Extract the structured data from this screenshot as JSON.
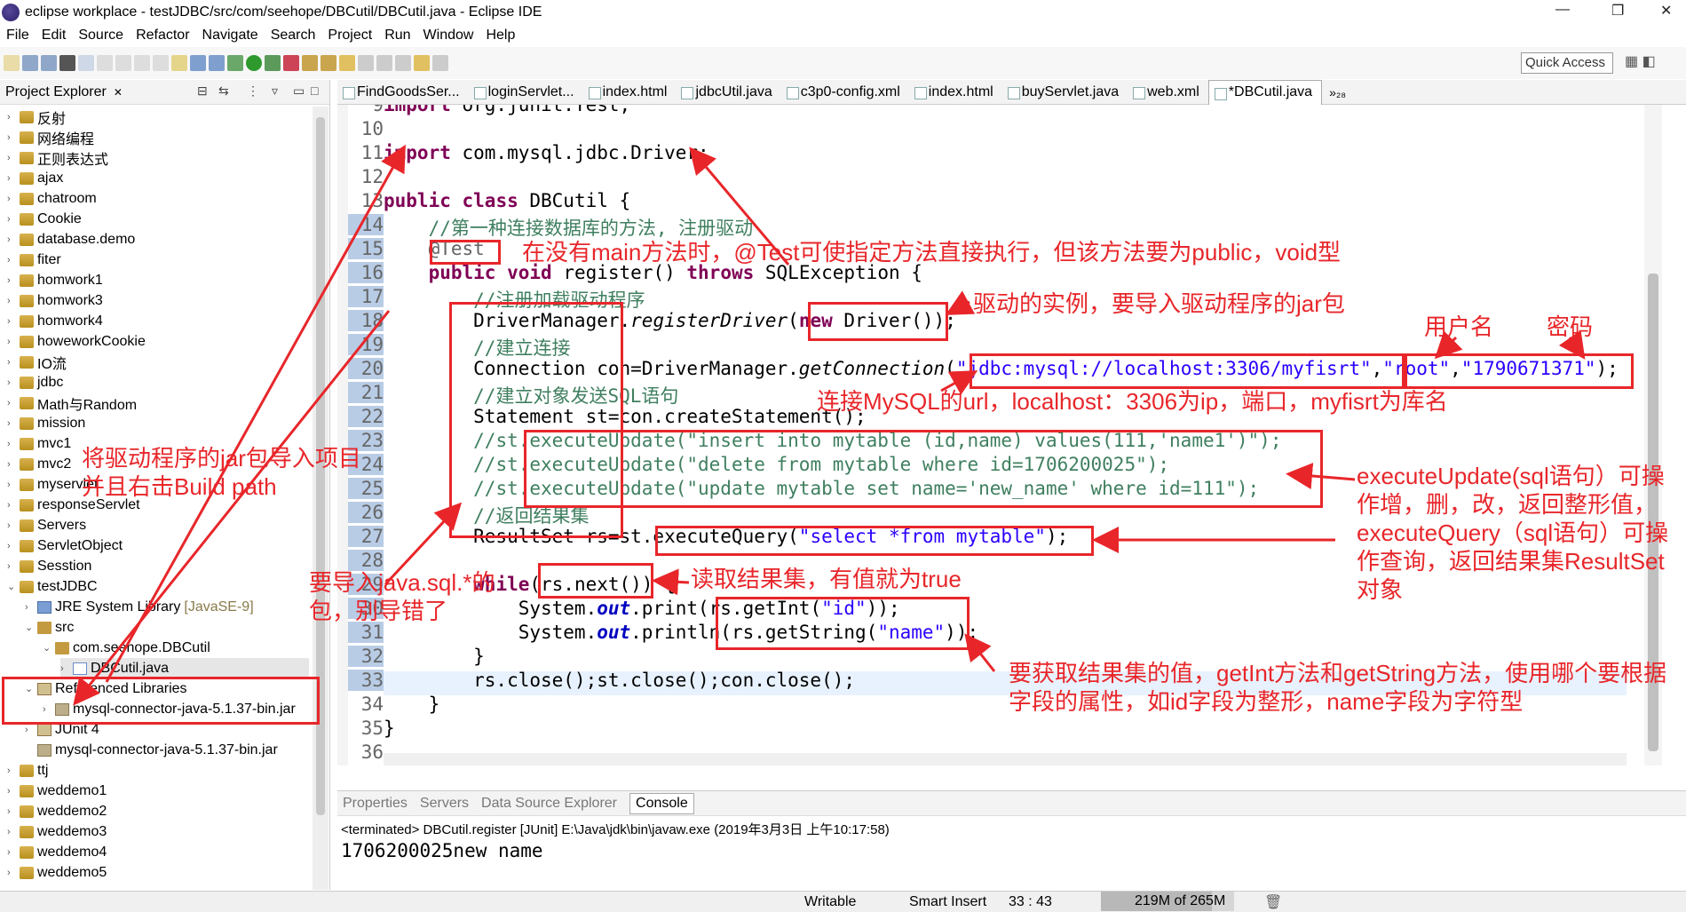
{
  "window": {
    "title": "eclipse workplace - testJDBC/src/com/seehope/DBCutil/DBCutil.java - Eclipse IDE"
  },
  "menu": [
    "File",
    "Edit",
    "Source",
    "Refactor",
    "Navigate",
    "Search",
    "Project",
    "Run",
    "Window",
    "Help"
  ],
  "toolbar": {
    "quick_access": "Quick Access"
  },
  "project_explorer": {
    "title": "Project Explorer",
    "items": [
      {
        "label": "反射",
        "indent": 0,
        "icon": "proj",
        "arrow": ">"
      },
      {
        "label": "网络编程",
        "indent": 0,
        "icon": "proj",
        "arrow": ">"
      },
      {
        "label": "正则表达式",
        "indent": 0,
        "icon": "proj",
        "arrow": ">"
      },
      {
        "label": "ajax",
        "indent": 0,
        "icon": "proj",
        "arrow": ">"
      },
      {
        "label": "chatroom",
        "indent": 0,
        "icon": "proj",
        "arrow": ">"
      },
      {
        "label": "Cookie",
        "indent": 0,
        "icon": "proj",
        "arrow": ">"
      },
      {
        "label": "database.demo",
        "indent": 0,
        "icon": "proj",
        "arrow": ">"
      },
      {
        "label": "fiter",
        "indent": 0,
        "icon": "proj",
        "arrow": ">"
      },
      {
        "label": "homwork1",
        "indent": 0,
        "icon": "proj",
        "arrow": ">"
      },
      {
        "label": "homwork3",
        "indent": 0,
        "icon": "proj",
        "arrow": ">"
      },
      {
        "label": "homwork4",
        "indent": 0,
        "icon": "proj",
        "arrow": ">"
      },
      {
        "label": "howeworkCookie",
        "indent": 0,
        "icon": "proj",
        "arrow": ">"
      },
      {
        "label": "IO流",
        "indent": 0,
        "icon": "proj",
        "arrow": ">"
      },
      {
        "label": "jdbc",
        "indent": 0,
        "icon": "proj",
        "arrow": ">"
      },
      {
        "label": "Math与Random",
        "indent": 0,
        "icon": "proj",
        "arrow": ">"
      },
      {
        "label": "mission",
        "indent": 0,
        "icon": "proj",
        "arrow": ">"
      },
      {
        "label": "mvc1",
        "indent": 0,
        "icon": "proj",
        "arrow": ">"
      },
      {
        "label": "mvc2",
        "indent": 0,
        "icon": "proj",
        "arrow": ">"
      },
      {
        "label": "myservlet",
        "indent": 0,
        "icon": "proj",
        "arrow": ">"
      },
      {
        "label": "responseServlet",
        "indent": 0,
        "icon": "proj",
        "arrow": ">"
      },
      {
        "label": "Servers",
        "indent": 0,
        "icon": "proj",
        "arrow": ">"
      },
      {
        "label": "ServletObject",
        "indent": 0,
        "icon": "proj",
        "arrow": ">"
      },
      {
        "label": "Sesstion",
        "indent": 0,
        "icon": "proj",
        "arrow": ">"
      },
      {
        "label": "testJDBC",
        "indent": 0,
        "icon": "proj",
        "arrow": "v"
      },
      {
        "label": "JRE System Library",
        "extra": "[JavaSE-9]",
        "indent": 1,
        "icon": "jre",
        "arrow": ">"
      },
      {
        "label": "src",
        "indent": 1,
        "icon": "pkg",
        "arrow": "v"
      },
      {
        "label": "com.seehope.DBCutil",
        "indent": 2,
        "icon": "pkg",
        "arrow": "v"
      },
      {
        "label": "DBCutil.java",
        "indent": 3,
        "icon": "java",
        "arrow": ">",
        "selected": true
      },
      {
        "label": "Referenced Libraries",
        "indent": 1,
        "icon": "lib",
        "arrow": "v"
      },
      {
        "label": "mysql-connector-java-5.1.37-bin.jar",
        "indent": 2,
        "icon": "jar",
        "arrow": ">"
      },
      {
        "label": "JUnit 4",
        "indent": 1,
        "icon": "lib",
        "arrow": ">"
      },
      {
        "label": "mysql-connector-java-5.1.37-bin.jar",
        "indent": 1,
        "icon": "jar",
        "arrow": ""
      },
      {
        "label": "ttj",
        "indent": 0,
        "icon": "proj",
        "arrow": ">"
      },
      {
        "label": "weddemo1",
        "indent": 0,
        "icon": "proj",
        "arrow": ">"
      },
      {
        "label": "weddemo2",
        "indent": 0,
        "icon": "proj",
        "arrow": ">"
      },
      {
        "label": "weddemo3",
        "indent": 0,
        "icon": "proj",
        "arrow": ">"
      },
      {
        "label": "weddemo4",
        "indent": 0,
        "icon": "proj",
        "arrow": ">"
      },
      {
        "label": "weddemo5",
        "indent": 0,
        "icon": "proj",
        "arrow": ">"
      }
    ]
  },
  "editor_tabs": [
    "FindGoodsSer...",
    "loginServlet...",
    "index.html",
    "jdbcUtil.java",
    "c3p0-config.xml",
    "index.html",
    "buyServlet.java",
    "web.xml",
    "*DBCutil.java"
  ],
  "editor_tabs_more": "»₂₈",
  "code_lines": [
    {
      "n": "9",
      "html": "<span class='kw'>import</span> org.junit.Test;"
    },
    {
      "n": "10",
      "html": ""
    },
    {
      "n": "11",
      "html": "<span class='kw'>import</span> com.mysql.jdbc.Driver;"
    },
    {
      "n": "12",
      "html": ""
    },
    {
      "n": "13",
      "html": "<span class='kw'>public</span> <span class='kw'>class</span> DBCutil {"
    },
    {
      "n": "14",
      "html": "    <span class='cm'>//第一种连接数据库的方法, 注册驱动</span>"
    },
    {
      "n": "15",
      "html": "    <span class='ann'>@Test</span>"
    },
    {
      "n": "16",
      "html": "    <span class='kw'>public</span> <span class='kw'>void</span> register() <span class='kw'>throws</span> SQLException {"
    },
    {
      "n": "17",
      "html": "        <span class='cm'>//注册加载驱动程序</span>"
    },
    {
      "n": "18",
      "html": "        DriverManager.<span class='it'>registerDriver</span>(<span class='kw'>new</span> Driver());"
    },
    {
      "n": "19",
      "html": "        <span class='cm'>//建立连接</span>"
    },
    {
      "n": "20",
      "html": "        Connection con=DriverManager.<span class='it'>getConnection</span>(<span class='str'>\"jdbc:mysql://localhost:3306/myfisrt\"</span>,<span class='str'>\"root\"</span>,<span class='str'>\"1790671371\"</span>);"
    },
    {
      "n": "21",
      "html": "        <span class='cm'>//建立对象发送SQL语句</span>"
    },
    {
      "n": "22",
      "html": "        Statement st=con.createStatement();"
    },
    {
      "n": "23",
      "html": "        <span class='cm'>//st.executeUpdate(\"insert into mytable (id,name) values(111,'name1')\");</span>"
    },
    {
      "n": "24",
      "html": "        <span class='cm'>//st.executeUpdate(\"delete from mytable where id=1706200025\");</span>"
    },
    {
      "n": "25",
      "html": "        <span class='cm'>//st.executeUpdate(\"update mytable set name='new_name' where id=111\");</span>"
    },
    {
      "n": "26",
      "html": "        <span class='cm'>//返回结果集</span>"
    },
    {
      "n": "27",
      "html": "        ResultSet rs=st.executeQuery(<span class='str'>\"select *from mytable\"</span>);"
    },
    {
      "n": "28",
      "html": ""
    },
    {
      "n": "29",
      "html": "        <span class='kw'>while</span>(rs.next()) {"
    },
    {
      "n": "30",
      "html": "            System.<span class='fld'>out</span>.print(rs.getInt(<span class='str'>\"id\"</span>));"
    },
    {
      "n": "31",
      "html": "            System.<span class='fld'>out</span>.println(rs.getString(<span class='str'>\"name\"</span>));"
    },
    {
      "n": "32",
      "html": "        }"
    },
    {
      "n": "33",
      "html": "        rs.close();st.close();con.close();"
    },
    {
      "n": "34",
      "html": "    }"
    },
    {
      "n": "35",
      "html": "}"
    },
    {
      "n": "36",
      "html": ""
    }
  ],
  "annotations": {
    "test": "在没有main方法时，@Test可使指定方法直接执行，但该方法要为public，void型",
    "driver": "驱动的实例，要导入驱动程序的jar包",
    "username": "用户名",
    "password": "密码",
    "url": "连接MySQL的url，localhost：3306为ip，端口，myfisrt为库名",
    "jar_import_1": "将驱动程序的jar包导入项目",
    "jar_import_2": "并且右击Build path",
    "exec_update_1": "executeUpdate(sql语句）可操",
    "exec_update_2": "作增，删，改，返回整形值，",
    "exec_query_1": "executeQuery（sql语句）可操",
    "exec_query_2": "作查询，返回结果集ResultSet",
    "exec_query_3": "对象",
    "rs_next": "读取结果集，有值就为true",
    "import_sql_1": "要导入java.sql.*的",
    "import_sql_2": "包，别导错了",
    "getvalue_1": "要获取结果集的值，getInt方法和getString方法，使用哪个要根据",
    "getvalue_2": "字段的属性，如id字段为整形，name字段为字符型"
  },
  "console": {
    "tabs": [
      "Properties",
      "Servers",
      "Data Source Explorer",
      "Console"
    ],
    "terminated": "<terminated> DBCutil.register [JUnit] E:\\Java\\jdk\\bin\\javaw.exe (2019年3月3日 上午10:17:58)",
    "output": "1706200025new name"
  },
  "status": {
    "writable": "Writable",
    "insert": "Smart Insert",
    "position": "33 : 43",
    "heap": "219M of 265M",
    "heap_used_fraction": 0.83
  },
  "colors": {
    "annotation": "#e8262a",
    "keyword": "#7f0055",
    "string": "#2a00ff",
    "comment": "#3f7f5f"
  }
}
